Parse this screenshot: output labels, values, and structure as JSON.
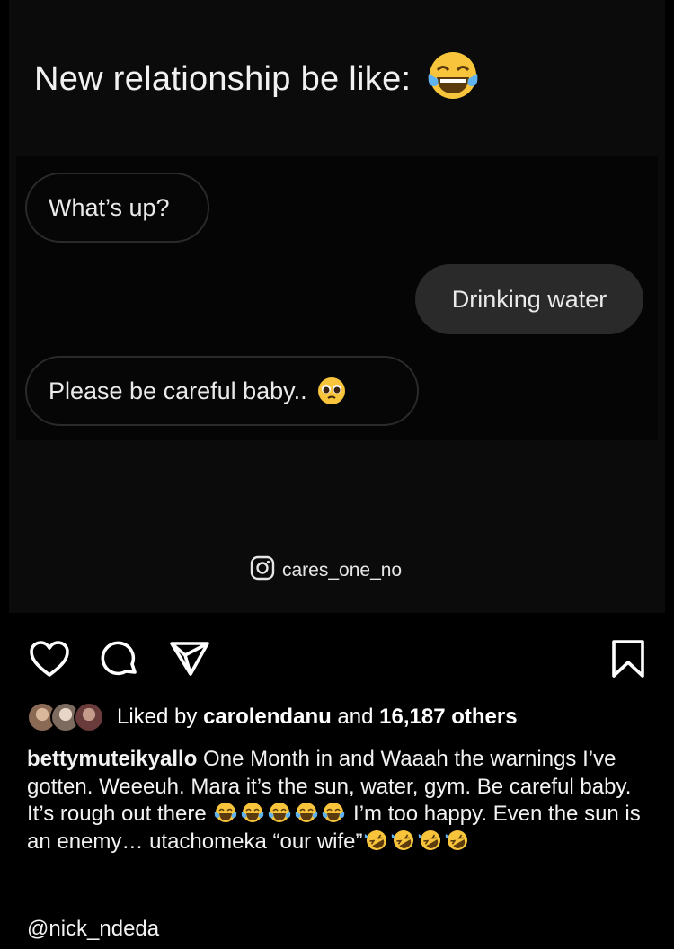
{
  "post": {
    "headline": "New relationship be like:",
    "headline_emoji": "face-with-tears-of-joy",
    "messages": [
      {
        "text": "What’s up?",
        "side": "received"
      },
      {
        "text": "Drinking water",
        "side": "sent"
      },
      {
        "text": "Please be careful baby..",
        "side": "received",
        "emoji": "pleading-face"
      }
    ],
    "watermark": "cares_one_no",
    "watermark_icon": "instagram-icon"
  },
  "actions": {
    "like": "heart-icon",
    "comment": "comment-icon",
    "share": "send-icon",
    "save": "bookmark-icon"
  },
  "likes": {
    "prefix": "Liked by ",
    "user": "carolendanu",
    "middle": " and ",
    "count": "16,187 others"
  },
  "caption": {
    "username": "bettymuteikyallo",
    "text_1": " One Month in and Waaah the warnings I’ve gotten. Weeeuh. Mara it’s the sun, water, gym. Be careful baby. It’s rough out there ",
    "emoji_run_1": [
      "face-with-tears-of-joy",
      "face-with-tears-of-joy",
      "face-with-tears-of-joy",
      "face-with-tears-of-joy",
      "face-with-tears-of-joy"
    ],
    "text_2": " I’m too happy. Even the sun is an enemy…  utachomeka “our wife”",
    "emoji_run_2": [
      "rolling-on-the-floor-laughing",
      "rolling-on-the-floor-laughing",
      "rolling-on-the-floor-laughing",
      "rolling-on-the-floor-laughing"
    ]
  },
  "tagged_user": "@nick_ndeda",
  "colors": {
    "background": "#000000",
    "bubble_sent": "#2a2a2a",
    "bubble_border": "#2a2a2a",
    "emoji_yellow": "#f7c43b"
  }
}
